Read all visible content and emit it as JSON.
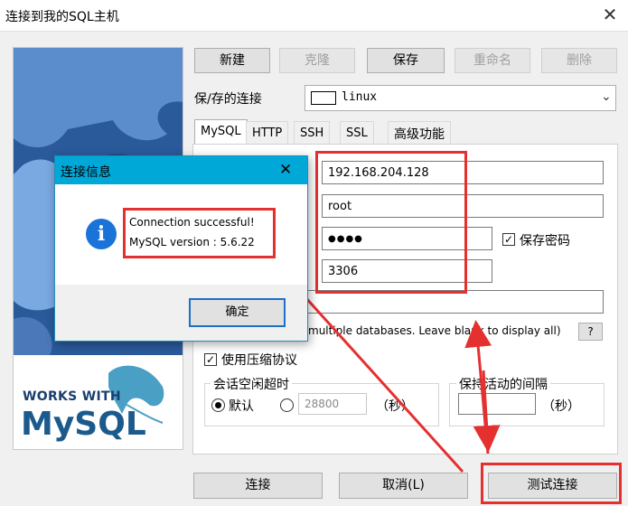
{
  "window": {
    "title": "连接到我的SQL主机",
    "close": "✕"
  },
  "toolbar": {
    "new_label": "新建",
    "clone_label": "克隆",
    "save_label": "保存",
    "rename_label": "重命名",
    "delete_label": "删除"
  },
  "saved_connection": {
    "label": "保/存的连接",
    "value": "linux"
  },
  "tabs": [
    "MySQL",
    "HTTP",
    "SSH",
    "SSL",
    "高级功能"
  ],
  "form": {
    "host": "192.168.204.128",
    "user": "root",
    "password": "●●●●",
    "save_password_label": "保存密码",
    "port": "3306",
    "database": "",
    "database_hint": "multiple databases. Leave blank to display all)",
    "help_label": "?",
    "compression_label": "使用压缩协议",
    "idle_group_label": "会话空闲超时",
    "default_label": "默认",
    "timeout_value": "28800",
    "seconds_label": "（秒）",
    "keepalive_label": "保持活动的间隔",
    "keepalive_value": "",
    "keepalive_seconds_label": "（秒）"
  },
  "bottom": {
    "connect_label": "连接",
    "cancel_label": "取消(L)",
    "test_label": "测试连接"
  },
  "dialog": {
    "title": "连接信息",
    "close": "✕",
    "line1": "Connection successful!",
    "line2": "MySQL version : 5.6.22",
    "ok_label": "确定",
    "info_glyph": "i"
  },
  "brand": {
    "works_with": "WORKS WITH",
    "mysql": "MySQL"
  },
  "colors": {
    "highlight": "#e53030",
    "dialog_title": "#00a8d8",
    "info": "#1a73d8"
  }
}
